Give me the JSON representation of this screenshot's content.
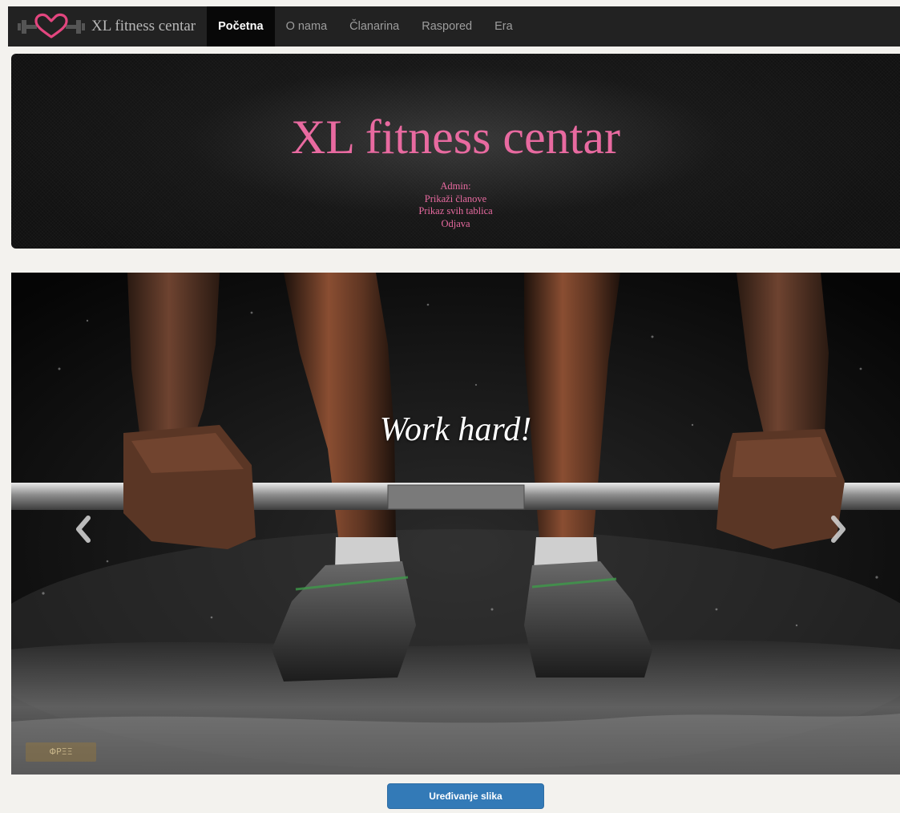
{
  "navbar": {
    "brand_text": "XL fitness centar",
    "items": [
      {
        "label": "Početna",
        "active": true
      },
      {
        "label": "O nama",
        "active": false
      },
      {
        "label": "Članarina",
        "active": false
      },
      {
        "label": "Raspored",
        "active": false
      },
      {
        "label": "Era",
        "active": false
      }
    ]
  },
  "hero": {
    "title": "XL fitness centar",
    "admin_label": "Admin:",
    "links": [
      "Prikaži članove",
      "Prikaz svih tablica",
      "Odjava"
    ]
  },
  "carousel": {
    "caption": "Work hard!",
    "watermark": "ΦΡΞΞ",
    "prev_icon": "chevron-left-icon",
    "next_icon": "chevron-right-icon"
  },
  "edit_button": {
    "label": "Uređivanje slika"
  },
  "colors": {
    "navbar_bg": "#222222",
    "nav_active_bg": "#080808",
    "accent_pink": "#e86aa0",
    "button_blue": "#337ab7",
    "page_bg": "#f3f2ee"
  }
}
